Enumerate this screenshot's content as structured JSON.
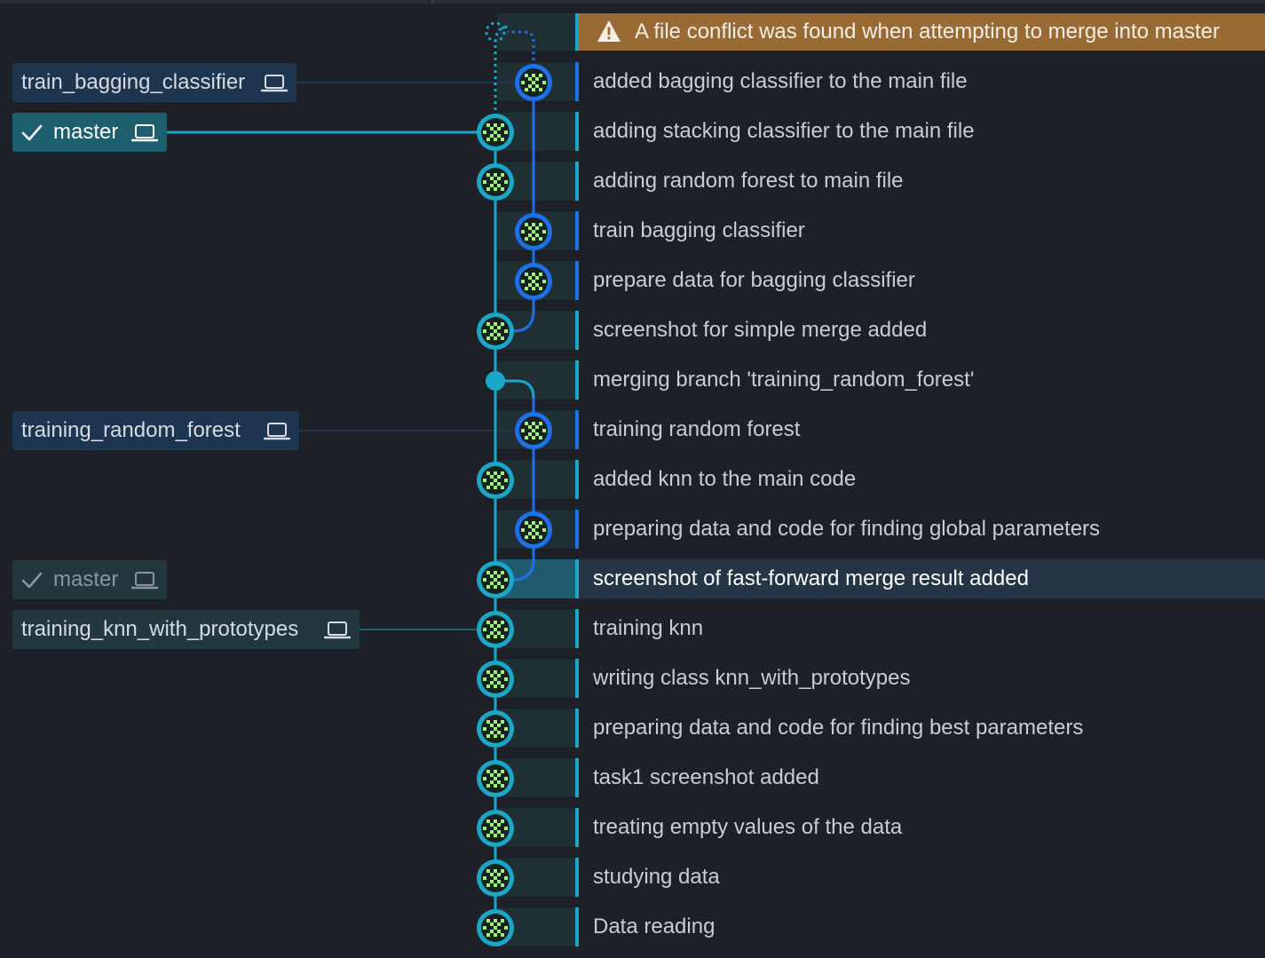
{
  "conflict_banner": {
    "icon": "warning-triangle-icon",
    "text": "A file conflict was found when attempting to merge into master",
    "color": "#9a6a35"
  },
  "branches": {
    "train_bagging_classifier": {
      "label": "train_bagging_classifier",
      "icon": "laptop-icon"
    },
    "master_current": {
      "label": "master",
      "icon": "laptop-icon",
      "checked": true
    },
    "training_random_forest": {
      "label": "training_random_forest",
      "icon": "laptop-icon"
    },
    "master_old": {
      "label": "master",
      "icon": "laptop-icon",
      "checked": true
    },
    "training_knn_with_prototypes": {
      "label": "training_knn_with_prototypes",
      "icon": "laptop-icon"
    }
  },
  "commits": [
    "added bagging classifier to the main file",
    "adding stacking classifier to the main file",
    "adding random forest to main file",
    "train bagging classifier",
    "prepare data for bagging classifier",
    "screenshot for simple merge added",
    "merging branch 'training_random_forest'",
    "training random forest",
    "added knn to the main code",
    "preparing data and code for finding global parameters",
    "screenshot of fast-forward merge result added",
    "training knn",
    "writing class knn_with_prototypes",
    "preparing data and code for finding best parameters",
    "task1 screenshot added",
    "treating empty values of the data",
    "studying data",
    "Data reading"
  ],
  "selected_commit": "screenshot of fast-forward merge result added",
  "colors": {
    "main_lane": "#1aa7c8",
    "branch_lane": "#1f6feb",
    "avatar_face": "#9ef07a",
    "background": "#1e2027"
  }
}
